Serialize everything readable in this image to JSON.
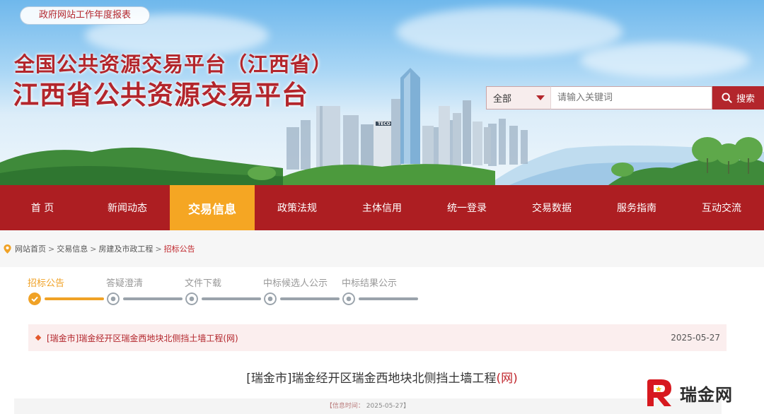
{
  "banner": {
    "report_link": "政府网站工作年度报表",
    "title_sub": "全国公共资源交易平台（江西省）",
    "title_main": "江西省公共资源交易平台"
  },
  "search": {
    "category": "全部",
    "placeholder": "请输入关键词",
    "button_label": "搜索"
  },
  "nav": {
    "items": [
      {
        "label": "首 页"
      },
      {
        "label": "新闻动态"
      },
      {
        "label": "交易信息"
      },
      {
        "label": "政策法规"
      },
      {
        "label": "主体信用"
      },
      {
        "label": "统一登录"
      },
      {
        "label": "交易数据"
      },
      {
        "label": "服务指南"
      },
      {
        "label": "互动交流"
      }
    ],
    "active_index": 2
  },
  "breadcrumb": {
    "items": [
      "网站首页",
      "交易信息",
      "房建及市政工程",
      "招标公告"
    ],
    "separators": [
      ">",
      ">",
      ">"
    ]
  },
  "steps": {
    "items": [
      {
        "label": "招标公告"
      },
      {
        "label": "答疑澄清"
      },
      {
        "label": "文件下载"
      },
      {
        "label": "中标候选人公示"
      },
      {
        "label": "中标结果公示"
      }
    ],
    "active_index": 0
  },
  "notice": {
    "title": "[瑞金市]瑞金经开区瑞金西地块北侧挡土墙工程(网)",
    "date": "2025-05-27"
  },
  "article": {
    "title_main": "[瑞金市]瑞金经开区瑞金西地块北侧挡土墙工程",
    "title_suffix": "(网)",
    "info_label": "【信息时间：",
    "info_date": "2025-05-27】"
  },
  "watermark": {
    "text": "瑞金网"
  },
  "colors": {
    "brand_red": "#ad1e22",
    "active_orange": "#f5a623",
    "step_active": "#f0a226",
    "step_inactive": "#9aa3ab"
  }
}
